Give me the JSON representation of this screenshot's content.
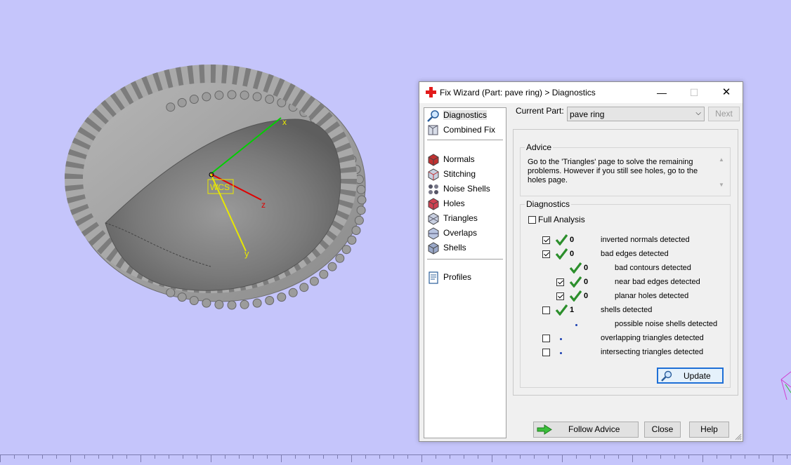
{
  "viewport": {
    "background": "#c5c5fb",
    "axes": {
      "x_label": "x",
      "y_label": "y",
      "z_label": "z",
      "origin_label": "WCS"
    }
  },
  "dialog": {
    "title": "Fix Wizard (Part: pave ring) > Diagnostics",
    "window_controls": {
      "minimize": "—",
      "maximize": "☐",
      "close": "✕"
    },
    "sidebar": {
      "items": [
        {
          "label": "Diagnostics",
          "icon": "magnifier-icon",
          "selected": true
        },
        {
          "label": "Combined Fix",
          "icon": "combined-fix-icon"
        },
        {
          "label": "Normals",
          "icon": "normals-icon"
        },
        {
          "label": "Stitching",
          "icon": "stitching-icon"
        },
        {
          "label": "Noise Shells",
          "icon": "noise-shells-icon"
        },
        {
          "label": "Holes",
          "icon": "holes-icon"
        },
        {
          "label": "Triangles",
          "icon": "triangles-icon"
        },
        {
          "label": "Overlaps",
          "icon": "overlaps-icon"
        },
        {
          "label": "Shells",
          "icon": "shells-icon"
        },
        {
          "label": "Profiles",
          "icon": "profiles-icon"
        }
      ]
    },
    "current_part": {
      "label": "Current Part:",
      "value": "pave ring"
    },
    "next_label": "Next",
    "advice": {
      "title": "Advice",
      "text": "Go to the 'Triangles' page to solve the remaining problems. However if you still see holes, go to the holes page."
    },
    "diagnostics": {
      "title": "Diagnostics",
      "full_analysis": {
        "label": "Full Analysis",
        "checked": false
      },
      "rows": [
        {
          "label": "inverted normals detected",
          "count": "0",
          "checked": true,
          "status": "ok"
        },
        {
          "label": "bad edges detected",
          "count": "0",
          "checked": true,
          "status": "ok"
        },
        {
          "label": "bad contours detected",
          "count": "0",
          "status": "ok"
        },
        {
          "label": "near bad edges detected",
          "count": "0",
          "checked": true,
          "status": "ok"
        },
        {
          "label": "planar holes detected",
          "count": "0",
          "checked": true,
          "status": "ok"
        },
        {
          "label": "shells detected",
          "count": "1",
          "checked": false,
          "status": "ok"
        },
        {
          "label": "possible noise shells detected",
          "status": "pending"
        },
        {
          "label": "overlapping triangles detected",
          "checked": false,
          "status": "pending"
        },
        {
          "label": "intersecting triangles detected",
          "checked": false,
          "status": "pending"
        }
      ],
      "update_label": "Update"
    },
    "buttons": {
      "follow_advice": "Follow Advice",
      "close": "Close",
      "help": "Help"
    }
  }
}
